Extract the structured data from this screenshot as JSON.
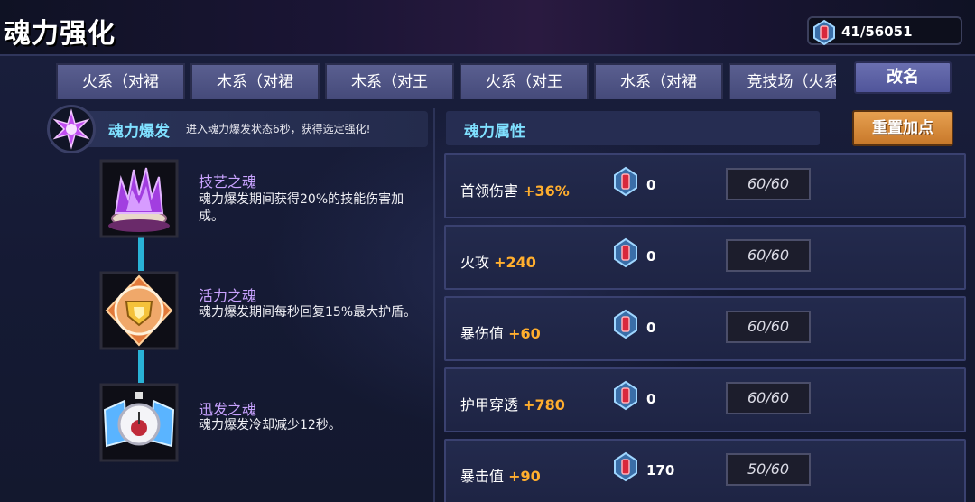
{
  "header": {
    "title": "魂力强化",
    "currency": {
      "icon": "soul-gem-icon",
      "value": "41/56051"
    }
  },
  "tabs": [
    {
      "label": "火系（对裙"
    },
    {
      "label": "木系（对裙"
    },
    {
      "label": "木系（对王"
    },
    {
      "label": "火系（对王"
    },
    {
      "label": "水系（对裙"
    },
    {
      "label": "竞技场（火系"
    }
  ],
  "rename_label": "改名",
  "burst": {
    "icon": "soul-burst-icon",
    "title": "魂力爆发",
    "description": "进入魂力爆发状态6秒，获得选定强化!"
  },
  "souls": [
    {
      "icon": "purple-flame-altar-icon",
      "name": "技艺之魂",
      "description": "魂力爆发期间获得20%的技能伤害加成。"
    },
    {
      "icon": "golden-shield-icon",
      "name": "活力之魂",
      "description": "魂力爆发期间每秒回复15%最大护盾。"
    },
    {
      "icon": "winged-stopwatch-icon",
      "name": "迅发之魂",
      "description": "魂力爆发冷却减少12秒。"
    }
  ],
  "attributes": {
    "title": "魂力属性",
    "reset_label": "重置加点",
    "rows": [
      {
        "name": "首领伤害",
        "bonus": "+36%",
        "cost": "0",
        "level": "60/60"
      },
      {
        "name": "火攻",
        "bonus": "+240",
        "cost": "0",
        "level": "60/60"
      },
      {
        "name": "暴伤值",
        "bonus": "+60",
        "cost": "0",
        "level": "60/60"
      },
      {
        "name": "护甲穿透",
        "bonus": "+780",
        "cost": "0",
        "level": "60/60"
      },
      {
        "name": "暴击值",
        "bonus": "+90",
        "cost": "170",
        "level": "50/60"
      }
    ]
  },
  "colors": {
    "accent_cyan": "#7fe0ff",
    "bonus_orange": "#ffae2e",
    "soul_name_purple": "#c9a3ff",
    "reset_button": "#d98a3a",
    "tab_bg": "#4f548a"
  }
}
